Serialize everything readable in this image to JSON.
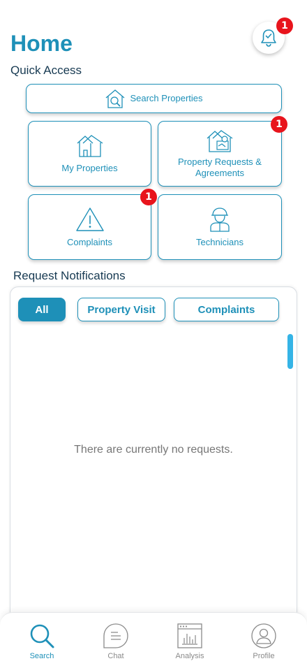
{
  "header": {
    "title": "Home",
    "notification_count": "1"
  },
  "quick_access": {
    "title": "Quick Access",
    "search_properties": "Search  Properties",
    "my_properties": "My Properties",
    "property_requests": "Property Requests & Agreements",
    "property_requests_badge": "1",
    "complaints": "Complaints",
    "complaints_badge": "1",
    "technicians": "Technicians"
  },
  "requests": {
    "title": "Request Notifications",
    "filters": [
      "All",
      "Property Visit",
      "Complaints"
    ],
    "active_filter": "All",
    "empty_message": "There are currently no requests."
  },
  "tabbar": {
    "items": [
      "Search",
      "Chat",
      "Analysis",
      "Profile"
    ],
    "active": "Search"
  },
  "colors": {
    "accent": "#1e90b8",
    "badge": "#e8141c",
    "scrollbar": "#35b4e6"
  }
}
